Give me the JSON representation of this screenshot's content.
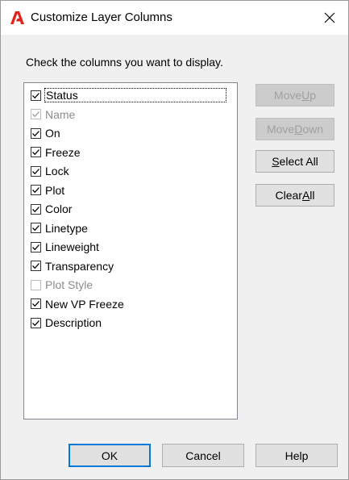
{
  "window": {
    "title": "Customize Layer Columns"
  },
  "instruction": "Check the columns you want to display.",
  "columns": [
    {
      "label": "Status",
      "checked": true,
      "enabled": true,
      "focused": true
    },
    {
      "label": "Name",
      "checked": true,
      "enabled": false,
      "focused": false
    },
    {
      "label": "On",
      "checked": true,
      "enabled": true,
      "focused": false
    },
    {
      "label": "Freeze",
      "checked": true,
      "enabled": true,
      "focused": false
    },
    {
      "label": "Lock",
      "checked": true,
      "enabled": true,
      "focused": false
    },
    {
      "label": "Plot",
      "checked": true,
      "enabled": true,
      "focused": false
    },
    {
      "label": "Color",
      "checked": true,
      "enabled": true,
      "focused": false
    },
    {
      "label": "Linetype",
      "checked": true,
      "enabled": true,
      "focused": false
    },
    {
      "label": "Lineweight",
      "checked": true,
      "enabled": true,
      "focused": false
    },
    {
      "label": "Transparency",
      "checked": true,
      "enabled": true,
      "focused": false
    },
    {
      "label": "Plot Style",
      "checked": false,
      "enabled": false,
      "focused": false
    },
    {
      "label": "New VP Freeze",
      "checked": true,
      "enabled": true,
      "focused": false
    },
    {
      "label": "Description",
      "checked": true,
      "enabled": true,
      "focused": false
    }
  ],
  "side_buttons": {
    "move_up": {
      "pre": "Move ",
      "key": "U",
      "post": "p",
      "enabled": false
    },
    "move_down": {
      "pre": "Move ",
      "key": "D",
      "post": "own",
      "enabled": false
    },
    "select_all": {
      "pre": "",
      "key": "S",
      "post": "elect All",
      "enabled": true
    },
    "clear_all": {
      "pre": "Clear ",
      "key": "A",
      "post": "ll",
      "enabled": true
    }
  },
  "bottom_buttons": {
    "ok": "OK",
    "cancel": "Cancel",
    "help": "Help"
  },
  "colors": {
    "app_icon": "#e2231a",
    "dialog_bg": "#f0f0f0",
    "disabled_text": "#8c8c8c"
  },
  "icons": {
    "app": "autocad-logo-icon",
    "close": "close-icon",
    "check": "checkmark-icon"
  }
}
